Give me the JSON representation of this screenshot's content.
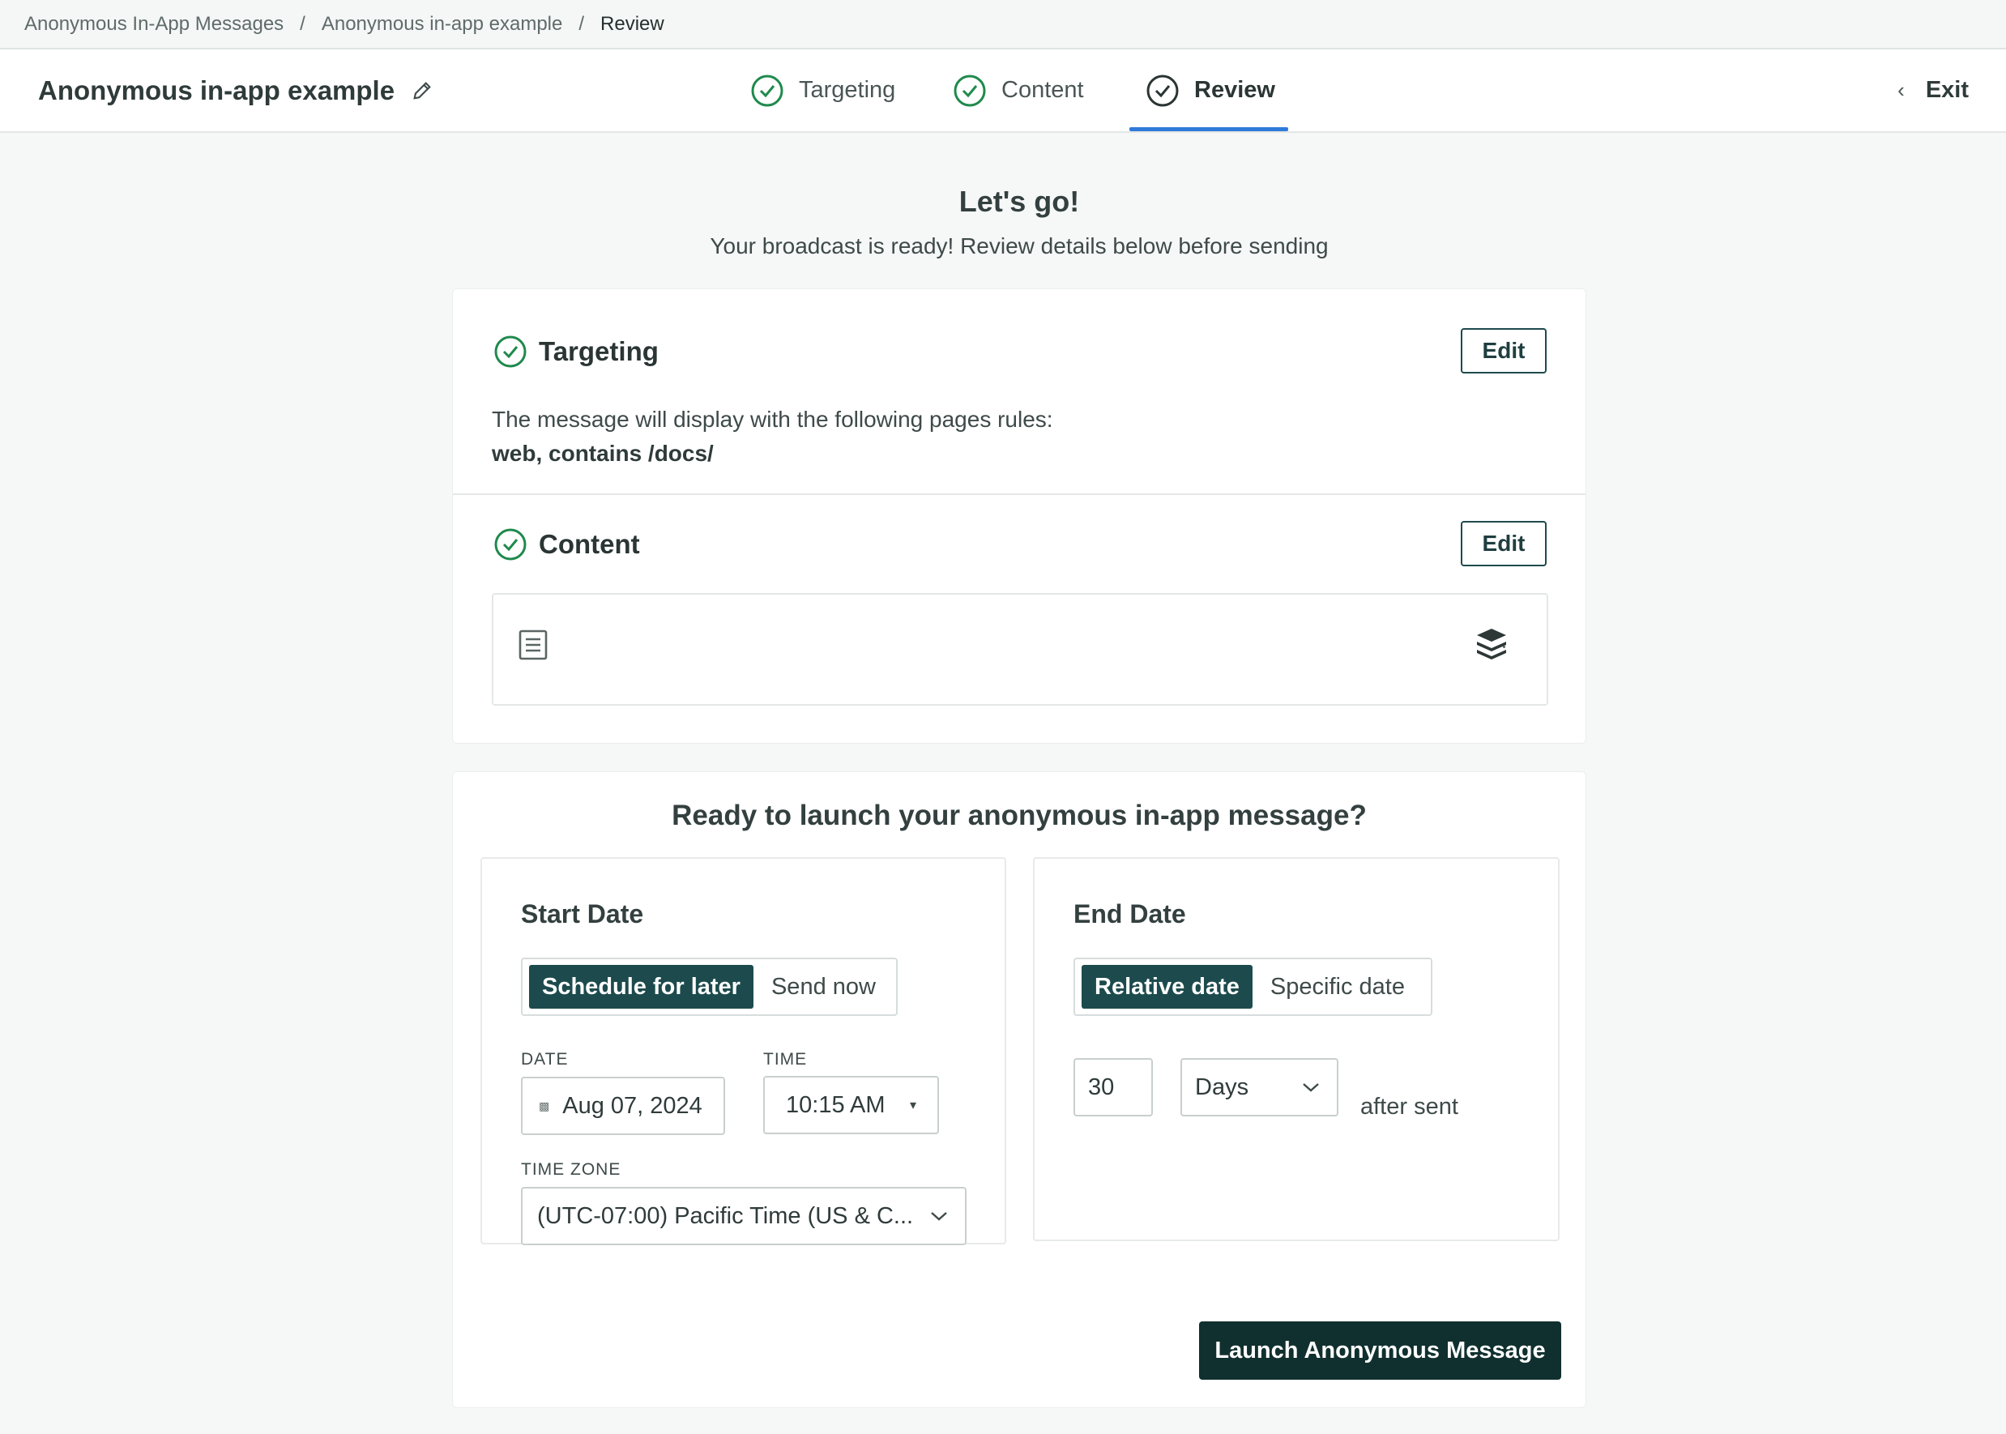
{
  "breadcrumb": {
    "items": [
      "Anonymous In-App Messages",
      "Anonymous in-app example",
      "Review"
    ],
    "separator": "/"
  },
  "header": {
    "title": "Anonymous in-app example",
    "steps": [
      {
        "label": "Targeting",
        "state": "complete"
      },
      {
        "label": "Content",
        "state": "complete"
      },
      {
        "label": "Review",
        "state": "active"
      }
    ],
    "exit_label": "Exit"
  },
  "intro": {
    "title": "Let's go!",
    "subtitle": "Your broadcast is ready! Review details below before sending"
  },
  "review": {
    "targeting": {
      "title": "Targeting",
      "edit_label": "Edit",
      "description": "The message will display with the following pages rules:",
      "rule": "web, contains /docs/"
    },
    "content": {
      "title": "Content",
      "edit_label": "Edit",
      "preview_icons": [
        "document-icon",
        "layers-icon"
      ]
    }
  },
  "launch": {
    "title": "Ready to launch your anonymous in-app message?",
    "start": {
      "title": "Start Date",
      "options": [
        "Schedule for later",
        "Send now"
      ],
      "selected": "Schedule for later",
      "date_label": "DATE",
      "date_value": "Aug 07, 2024",
      "time_label": "TIME",
      "time_value": "10:15 AM",
      "timezone_label": "TIME ZONE",
      "timezone_value": "(UTC-07:00) Pacific Time (US & C..."
    },
    "end": {
      "title": "End Date",
      "options": [
        "Relative date",
        "Specific date"
      ],
      "selected": "Relative date",
      "amount": "30",
      "unit": "Days",
      "suffix": "after sent"
    },
    "button_label": "Launch Anonymous Message"
  },
  "colors": {
    "accent_dark": "#10302f",
    "toggle_on": "#1d4b4d",
    "success_green": "#1f8a4c",
    "active_tab_underline": "#2f7ad8"
  }
}
